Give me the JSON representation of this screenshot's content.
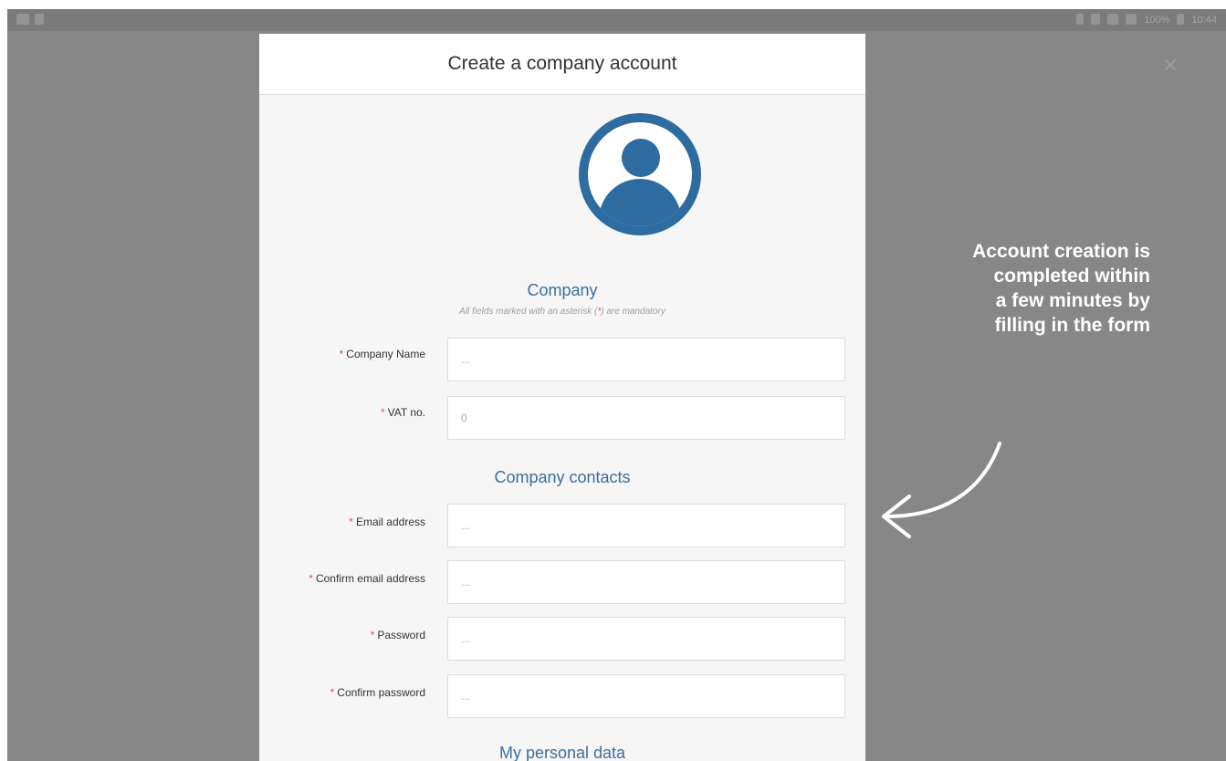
{
  "status_bar": {
    "left_icons": [
      "image-icon",
      "notification-icon"
    ],
    "right_icons": [
      "bluetooth-icon",
      "nfc-icon",
      "wifi-icon",
      "signal-icon"
    ],
    "battery_text": "100%",
    "time": "10:44"
  },
  "modal": {
    "title": "Create a company account",
    "close_icon": "close-icon",
    "avatar_icon": "user-avatar-icon"
  },
  "form": {
    "company_section": {
      "title": "Company",
      "note_before": "All fields marked with an asterisk (",
      "note_asterisk": "*",
      "note_after": ") are mandatory"
    },
    "required_marker": "*",
    "fields": {
      "company_name": {
        "label": "Company Name",
        "placeholder": "..."
      },
      "vat_no": {
        "label": "VAT no.",
        "placeholder": "0"
      },
      "email": {
        "label": "Email address",
        "placeholder": "..."
      },
      "confirm_email": {
        "label": "Confirm email address",
        "placeholder": "..."
      },
      "password": {
        "label": "Password",
        "placeholder": "..."
      },
      "confirm_password": {
        "label": "Confirm password",
        "placeholder": "..."
      }
    },
    "contacts_section": {
      "title": "Company contacts"
    },
    "personal_section": {
      "title": "My personal data"
    }
  },
  "annotation": {
    "line1": "Account creation is",
    "line2": "completed within",
    "line3": "a few minutes by",
    "line4": "filling in the form"
  },
  "colors": {
    "backdrop": "#878787",
    "accent": "#2e6ba0",
    "section_title": "#3d6f9c",
    "required": "#d9534f"
  }
}
